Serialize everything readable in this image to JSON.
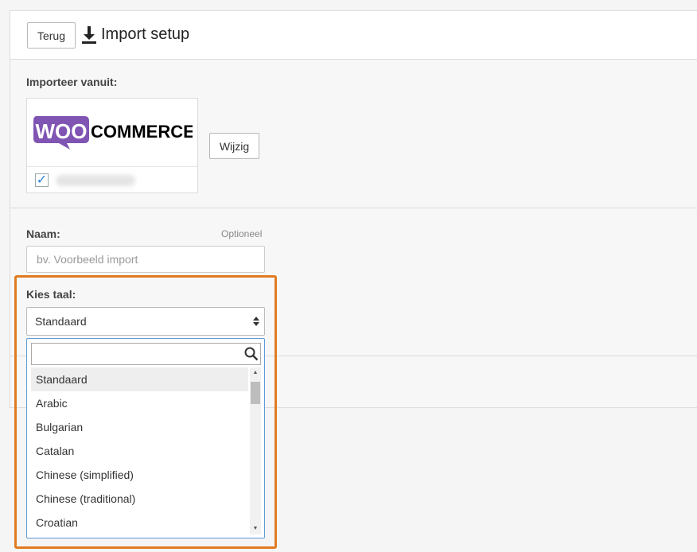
{
  "header": {
    "back_label": "Terug",
    "title": "Import setup",
    "icon": "download-icon"
  },
  "source": {
    "label": "Importeer vanuit:",
    "logo_text_woo": "WOO",
    "logo_text_commerce": "COMMERCE",
    "checked": true,
    "change_label": "Wijzig",
    "brand_color": "#7f54b3"
  },
  "name": {
    "label": "Naam:",
    "optional": "Optioneel",
    "placeholder": "bv. Voorbeeld import",
    "value": ""
  },
  "language": {
    "label": "Kies taal:",
    "selected": "Standaard",
    "search_value": "",
    "options": [
      "Standaard",
      "Arabic",
      "Bulgarian",
      "Catalan",
      "Chinese (simplified)",
      "Chinese (traditional)",
      "Croatian"
    ]
  },
  "colors": {
    "highlight": "#e07b22",
    "dropdown_border": "#5b9bd5",
    "check": "#2a7fd6"
  }
}
